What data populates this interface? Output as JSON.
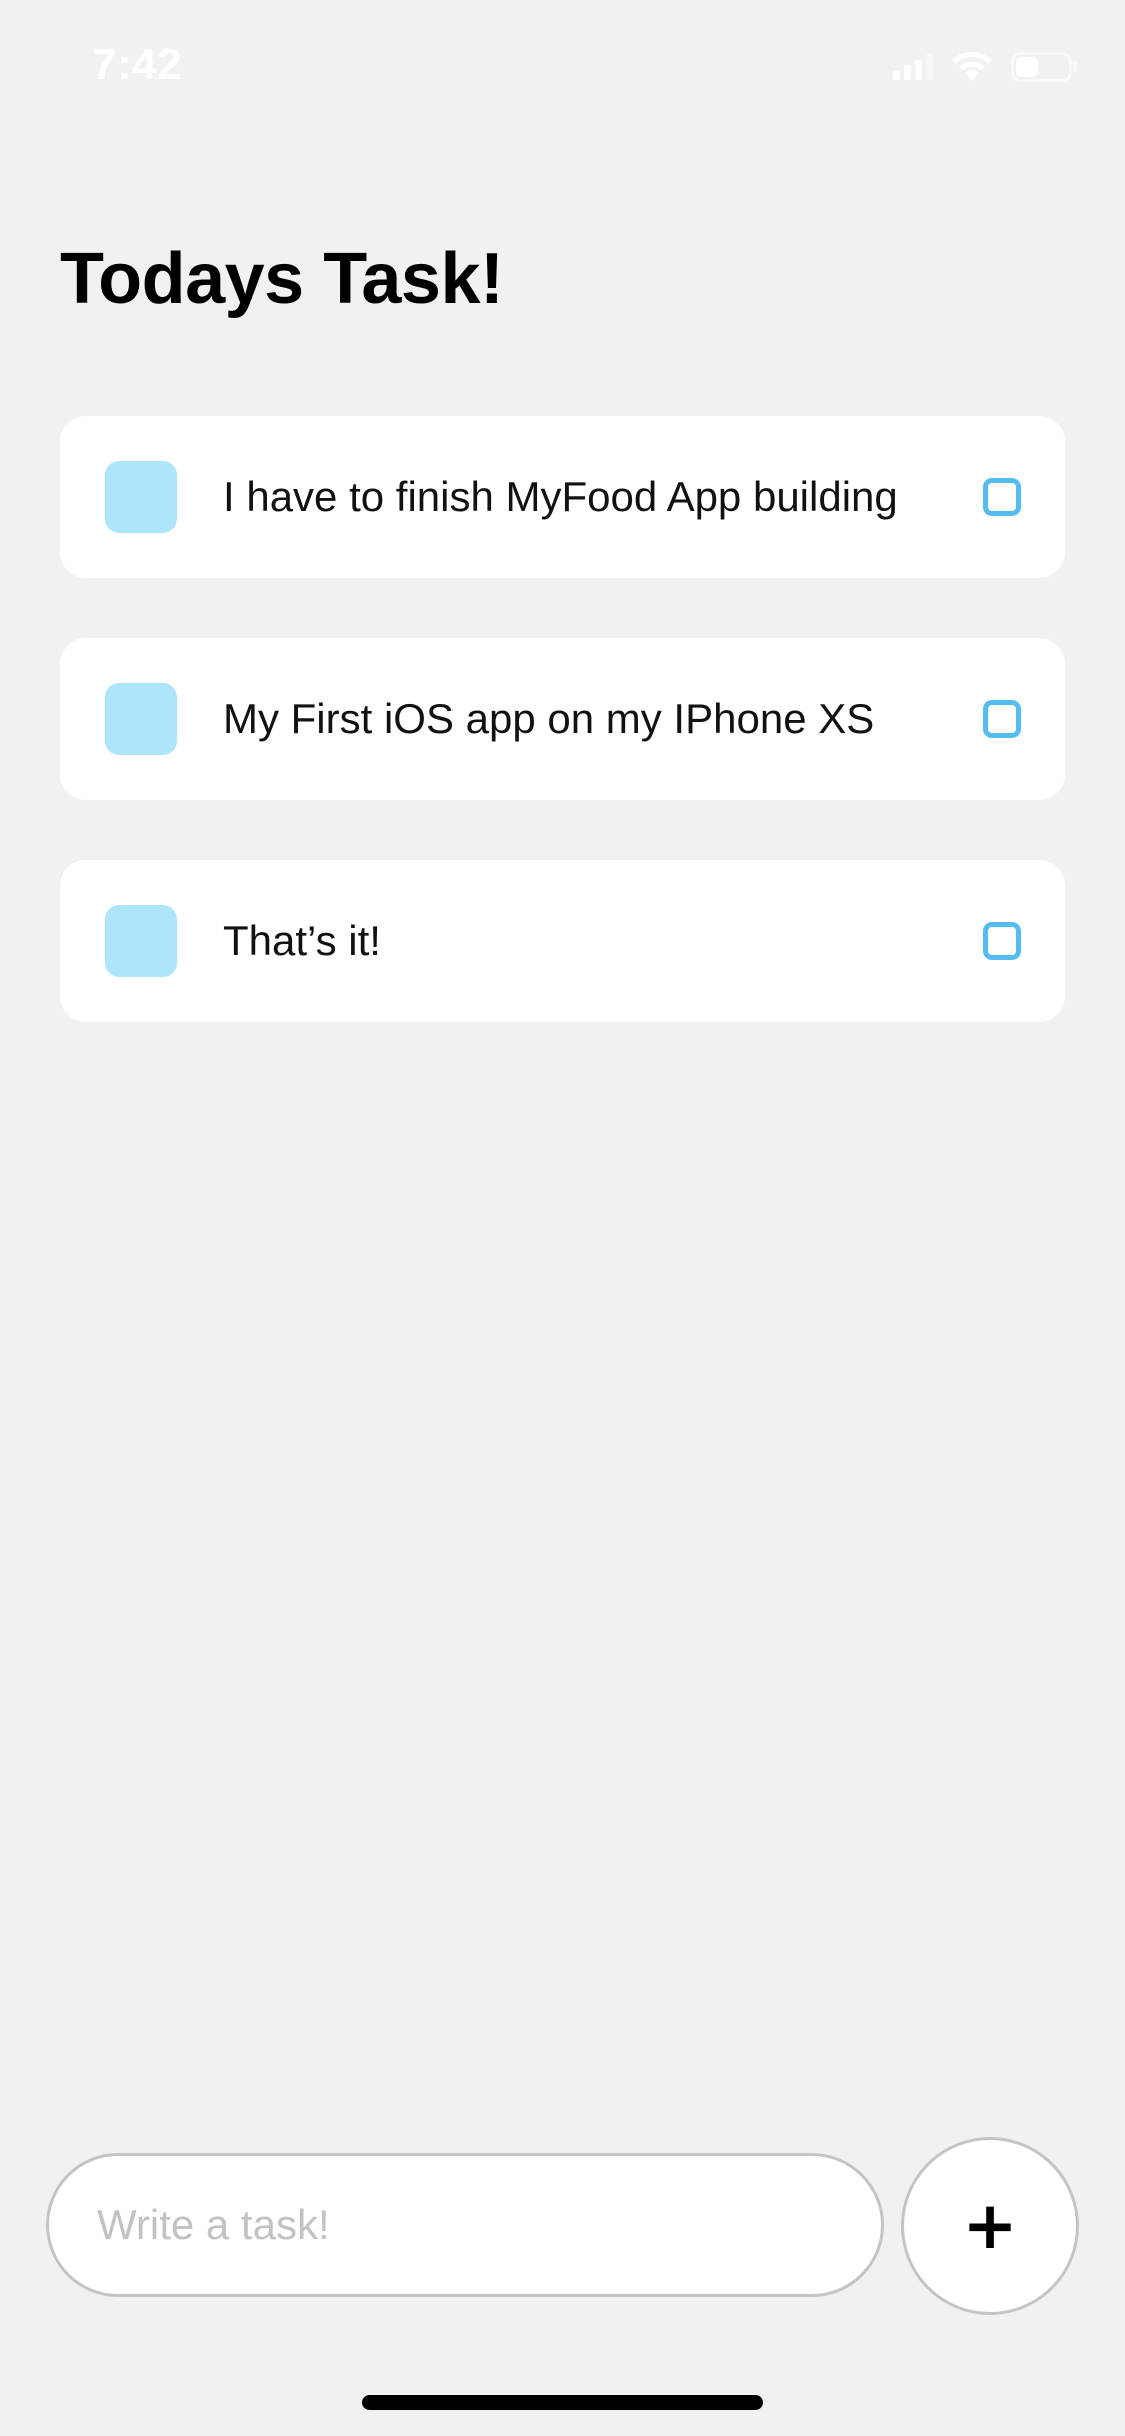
{
  "status_bar": {
    "time": "7:42",
    "icons": [
      "cellular-signal-icon",
      "wifi-icon",
      "battery-icon"
    ]
  },
  "header": {
    "title": "Todays Task!"
  },
  "tasks": [
    {
      "text": "I have to finish MyFood App building",
      "completed": false
    },
    {
      "text": "My First iOS app on my IPhone XS",
      "completed": false
    },
    {
      "text": "That’s it!",
      "completed": false
    }
  ],
  "composer": {
    "placeholder": "Write a task!",
    "value": "",
    "add_label": "+"
  },
  "colors": {
    "background": "#F1F1F1",
    "card": "#FFFFFF",
    "task_square": "#ADE5FB",
    "checkbox_border": "#55BCEF",
    "input_border": "#C4C4C4",
    "placeholder": "#C2C2C2"
  }
}
